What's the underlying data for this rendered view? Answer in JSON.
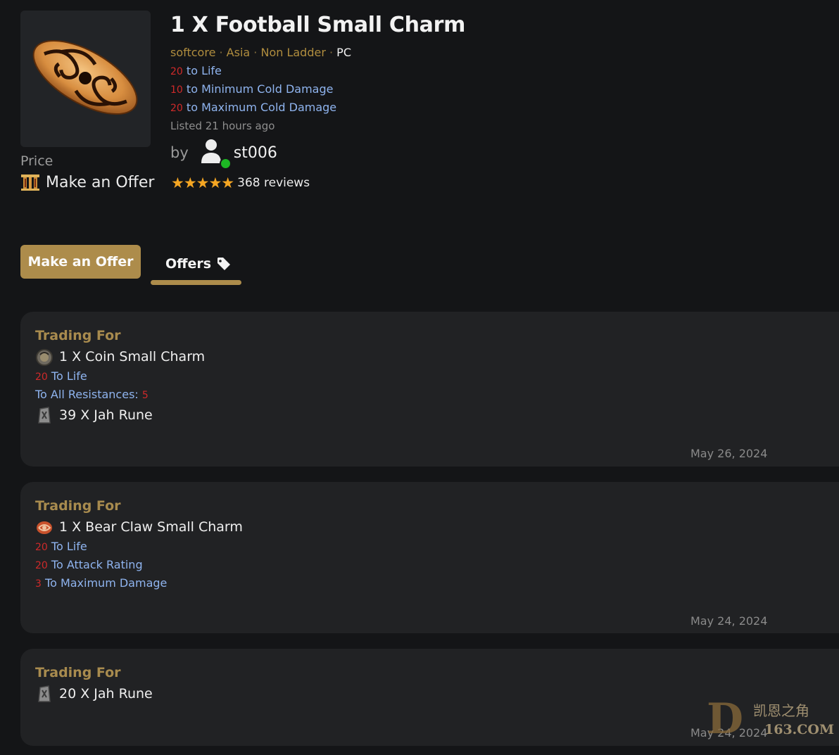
{
  "item": {
    "title": "1 X Football Small Charm",
    "meta": {
      "mode": "softcore",
      "region": "Asia",
      "ladder": "Non Ladder",
      "platform": "PC",
      "separator": " · "
    },
    "stats": [
      {
        "value": "20",
        "text": " to Life"
      },
      {
        "value": "10",
        "text": " to Minimum Cold Damage"
      },
      {
        "value": "20",
        "text": " to Maximum Cold Damage"
      }
    ],
    "listed": "Listed 21 hours ago",
    "image_icon": "charm-icon"
  },
  "price": {
    "label": "Price",
    "value": "Make an Offer",
    "icon": "pillar-icon"
  },
  "seller": {
    "by_label": "by",
    "name": "st006",
    "status_color": "#1db824",
    "stars": "★★★★★",
    "reviews": "368 reviews"
  },
  "actions": {
    "make_offer": "Make an Offer"
  },
  "tabs": {
    "offers": "Offers",
    "icon": "tag-icon"
  },
  "offers": [
    {
      "heading": "Trading For",
      "item1": "1 X Coin Small Charm",
      "stat1_value": "20",
      "stat1_text": " To Life",
      "stat2_text": "To All Resistances: ",
      "stat2_value": "5",
      "item2": "39 X Jah Rune",
      "date": "May 26, 2024"
    },
    {
      "heading": "Trading For",
      "item1": "1 X Bear Claw Small Charm",
      "stat1_value": "20",
      "stat1_text": " To Life",
      "stat2_value": "20",
      "stat2_text": " To Attack Rating",
      "stat3_value": "3",
      "stat3_text": " To Maximum Damage",
      "date": "May 24, 2024"
    },
    {
      "heading": "Trading For",
      "item1": "20 X Jah Rune",
      "date": "May 24, 2024"
    }
  ],
  "watermark": {
    "line1": "凯恩之角",
    "line2": "163.COM",
    "letter": "D"
  },
  "colors": {
    "accent": "#ad8c4b",
    "stat_blue": "#8fb4ef",
    "stat_red": "#cf2a2a",
    "background": "#141517",
    "card": "#212224"
  }
}
